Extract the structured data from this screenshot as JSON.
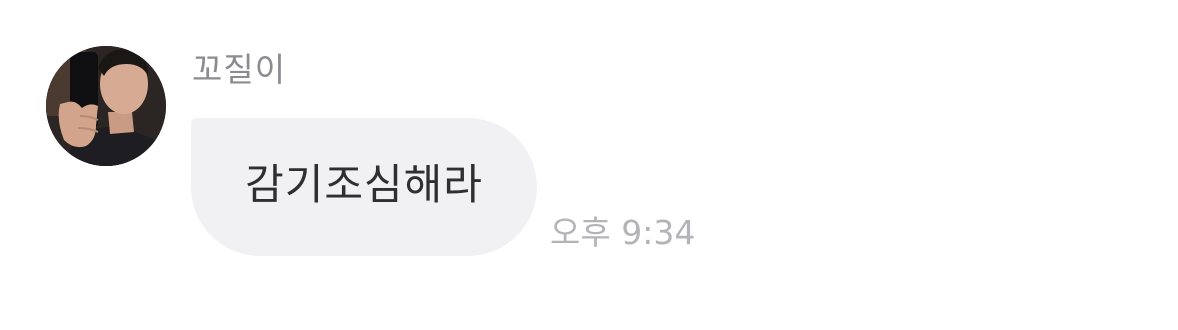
{
  "message": {
    "sender_name": "꼬질이",
    "text": "감기조심해라",
    "time": "오후 9:34",
    "avatar_icon": "profile-photo-avatar"
  },
  "colors": {
    "bubble": "#f1f1f4",
    "sender_name": "#8b8b90",
    "message_text": "#2f2f33",
    "timestamp": "#b4b4b8"
  }
}
